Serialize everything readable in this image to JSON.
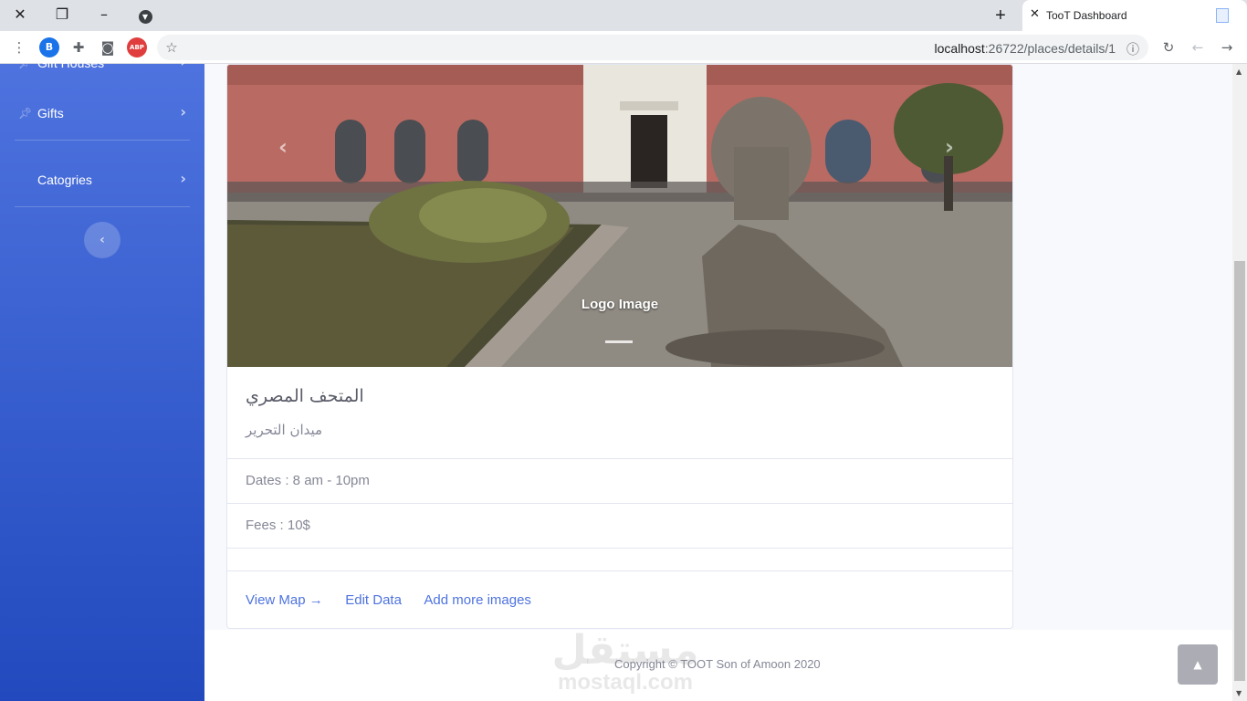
{
  "browser": {
    "tab_title": "TooT Dashboard",
    "url_host": "localhost",
    "url_rest": ":26722/places/details/1",
    "ext_b_label": "B",
    "ext_abp_label": "ABP"
  },
  "sidebar": {
    "items": [
      {
        "label": "Gift Houses"
      },
      {
        "label": "Gifts"
      },
      {
        "label": "Catogries"
      }
    ]
  },
  "place": {
    "carousel_caption": "Logo Image",
    "name": "المتحف المصري",
    "address": "ميدان التحرير",
    "dates": "Dates : 8 am - 10pm",
    "fees": "Fees : 10$"
  },
  "links": {
    "view_map": "View Map →",
    "edit_data": "Edit Data",
    "add_images": "Add more images"
  },
  "footer": {
    "copyright": "Copyright © TOOT Son of Amoon 2020",
    "watermark_ar": "مستقل",
    "watermark_en": "mostaql.com"
  },
  "colors": {
    "sidebar_gradient_top": "#4e73df",
    "sidebar_gradient_bottom": "#224abe",
    "link": "#4e73df"
  }
}
